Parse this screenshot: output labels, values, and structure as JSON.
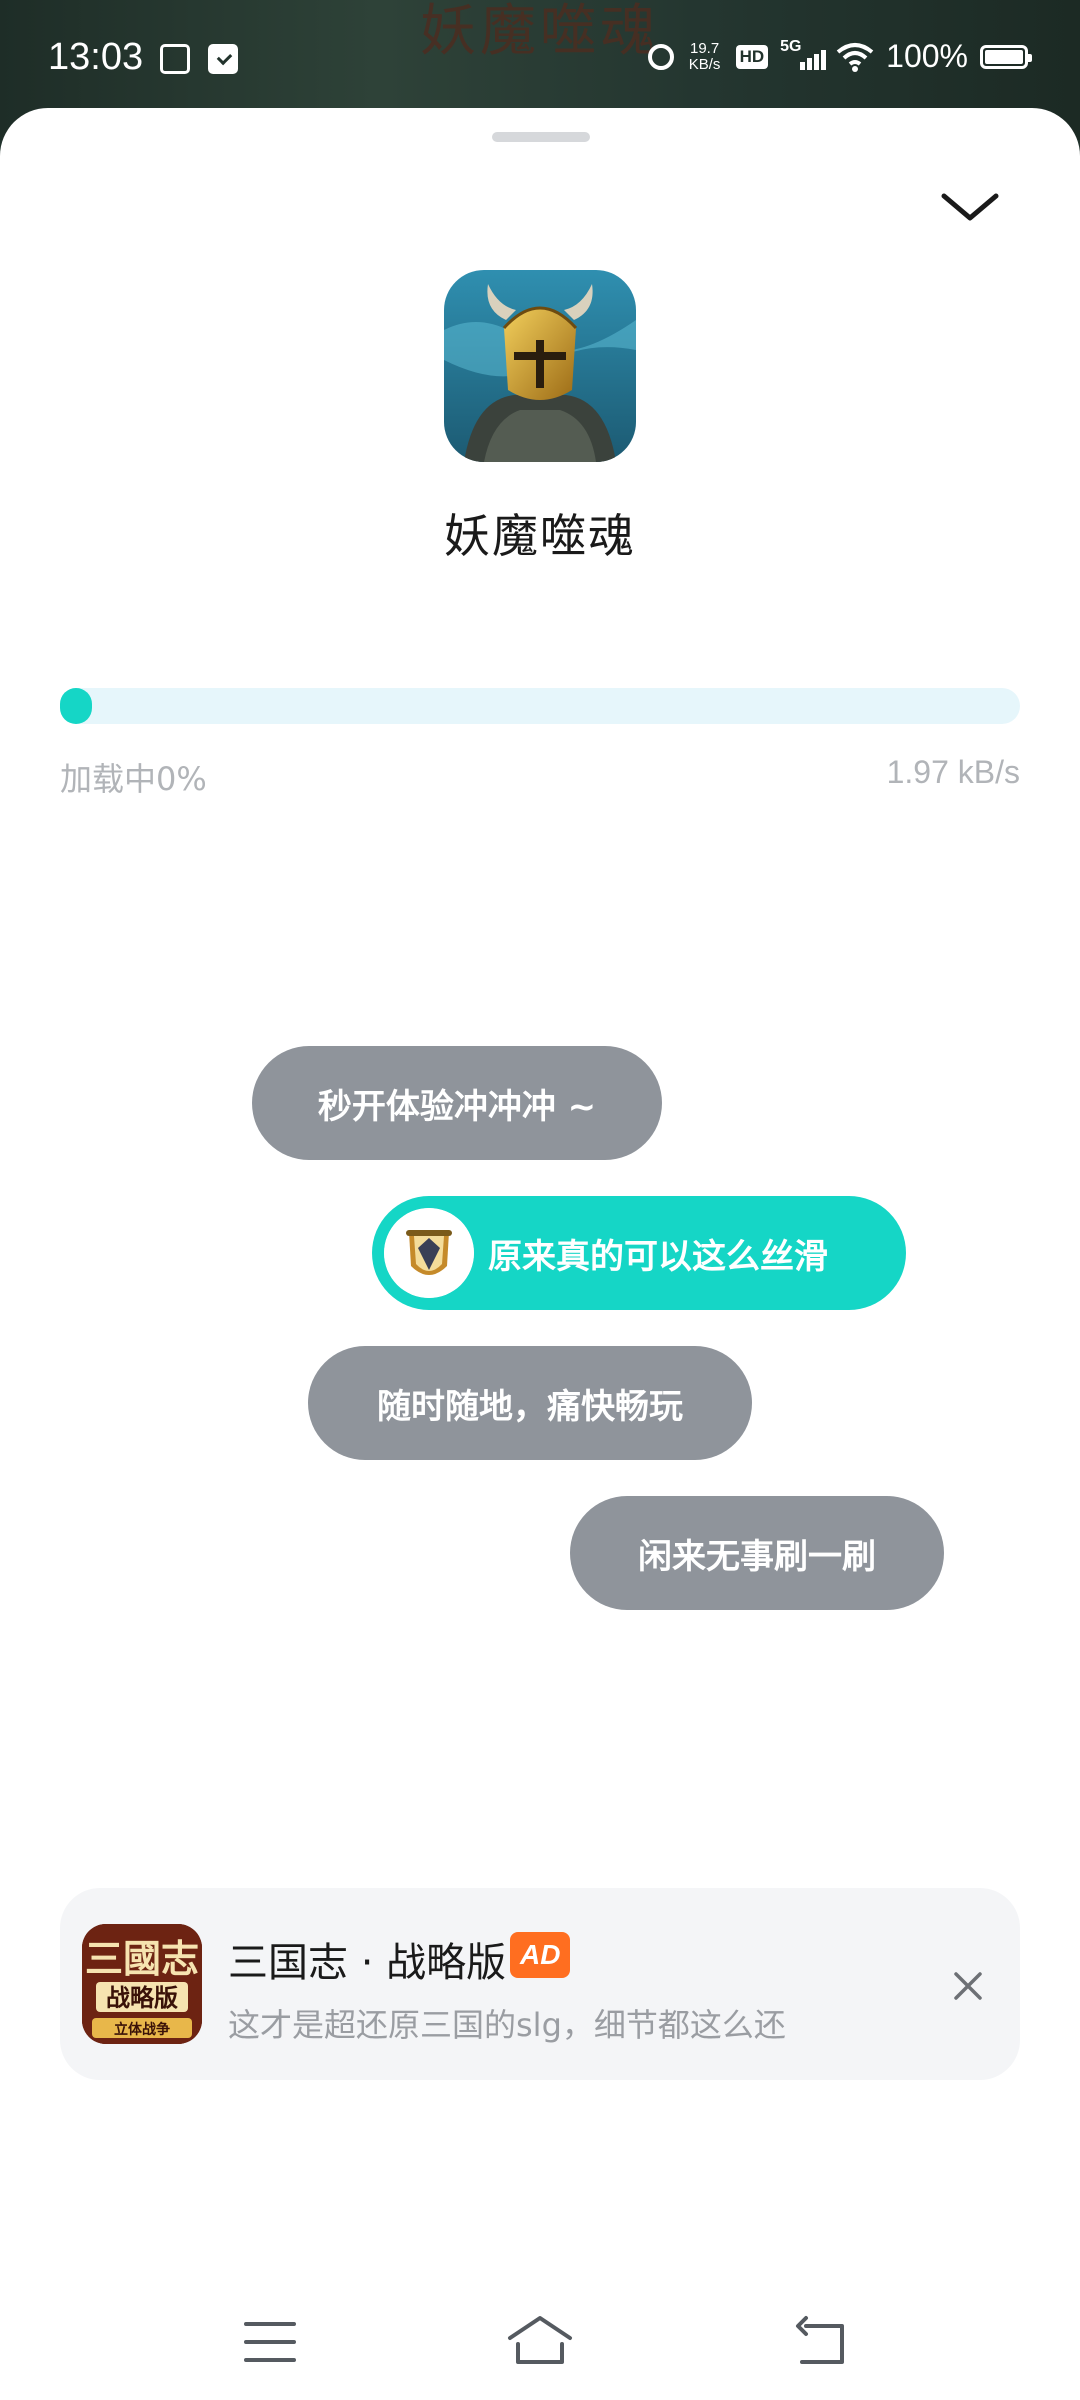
{
  "status_bar": {
    "time": "13:03",
    "net_speed_value": "19.7",
    "net_speed_unit": "KB/s",
    "hd_label": "HD",
    "network_label": "5G",
    "battery_text": "100%",
    "battery_level": 1.0
  },
  "background": {
    "title": "妖魔噬魂"
  },
  "app": {
    "name": "妖魔噬魂",
    "icon": "helmet-warrior-icon"
  },
  "loading": {
    "label": "加载中0%",
    "progress": 0,
    "speed": "1.97 kB/s"
  },
  "chat": {
    "messages": [
      {
        "text": "秒开体验冲冲冲 ~",
        "style": "gray"
      },
      {
        "text": "原来真的可以这么丝滑",
        "style": "teal",
        "avatar": "crest-avatar"
      },
      {
        "text": "随时随地，痛快畅玩",
        "style": "gray"
      },
      {
        "text": "闲来无事刷一刷",
        "style": "gray"
      }
    ]
  },
  "ad": {
    "title": "三国志 · 战略版",
    "badge": "AD",
    "description": "这才是超还原三国的slg，细节都这么还",
    "icon_title": "三國志",
    "icon_subtitle": "战略版",
    "icon_footer": "立体战争"
  },
  "colors": {
    "accent": "#15d6c6",
    "bubble_gray": "#8f949b",
    "progress_track": "#e6f6fb",
    "ad_badge": "#ff6e20"
  },
  "nav": {
    "menu_icon": "menu-icon",
    "home_icon": "home-icon",
    "back_icon": "back-icon"
  }
}
